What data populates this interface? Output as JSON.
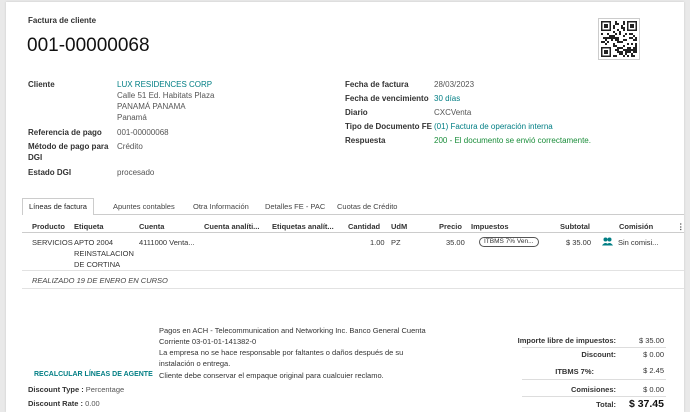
{
  "header": {
    "subtitle": "Factura de cliente",
    "number": "001-00000068"
  },
  "left_fields": {
    "cliente_label": "Cliente",
    "cliente_name": "LUX RESIDENCES CORP",
    "addr1": "Calle 51 Ed. Habitats Plaza",
    "addr2": "PANAMÁ PANAMA",
    "addr3": "Panamá",
    "ref_label": "Referencia de pago",
    "ref_value": "001-00000068",
    "metodo_label1": "Método de pago para",
    "metodo_label2": "DGI",
    "metodo_value": "Crédito",
    "estado_label": "Estado DGI",
    "estado_value": "procesado"
  },
  "right_fields": {
    "fecha_label": "Fecha de factura",
    "fecha_value": "28/03/2023",
    "venc_label": "Fecha de vencimiento",
    "venc_value": "30 días",
    "diario_label": "Diario",
    "diario_value": "CXCVenta",
    "tipo_label": "Tipo de Documento FE",
    "tipo_value": "(01) Factura de operación interna",
    "resp_label": "Respuesta",
    "resp_value": "200 - El documento se envió correctamente."
  },
  "tabs": [
    "Líneas de factura",
    "Apuntes contables",
    "Otra Información",
    "Detalles FE - PAC",
    "Cuotas de Crédito"
  ],
  "columns": {
    "producto": "Producto",
    "etiqueta": "Etiqueta",
    "cuenta": "Cuenta",
    "cuenta_analitica": "Cuenta analíti...",
    "etiquetas_analiticas": "Etiquetas analít...",
    "cantidad": "Cantidad",
    "udm": "UdM",
    "precio": "Precio",
    "impuestos": "Impuestos",
    "subtotal": "Subtotal",
    "comision": "Comisión"
  },
  "line": {
    "producto": "SERVICIOS",
    "etiqueta1": "APTO 2004",
    "etiqueta2": "REINSTALACION",
    "etiqueta3": "DE CORTINA",
    "cuenta": "4111000 Venta...",
    "cantidad": "1.00",
    "udm": "PZ",
    "precio": "35.00",
    "impuesto": "ITBMS 7% Ven...",
    "subtotal": "$ 35.00",
    "comision": "Sin comisi..."
  },
  "note_line": "REALIZADO 19 DE ENERO EN CURSO",
  "terms": {
    "l1": "Pagos en ACH - Telecommunication and Networking Inc. Banco General Cuenta",
    "l2": "Corriente 03-01-01-141382-0",
    "l3": "La empresa no se hace responsable por faltantes o daños después de su",
    "l4": "instalación o entrega.",
    "l5": "Cliente debe conservar el empaque original para cualcuier reclamo."
  },
  "recalc_label": "RECALCULAR LÍNEAS DE AGENTE",
  "discount": {
    "type_label": "Discount Type :",
    "type_value": "Percentage",
    "rate_label": "Discount Rate :",
    "rate_value": "0.00"
  },
  "totals": {
    "base_label": "Importe libre de impuestos:",
    "base_value": "$ 35.00",
    "discount_label": "Discount:",
    "discount_value": "$ 0.00",
    "itbms_label": "ITBMS 7%:",
    "itbms_value": "$ 2.45",
    "comisiones_label": "Comisiones:",
    "comisiones_value": "$ 0.00",
    "total_label": "Total:",
    "total_value": "$ 37.45"
  },
  "colors": {
    "link": "#017e84",
    "ok": "#1a8d3a"
  }
}
